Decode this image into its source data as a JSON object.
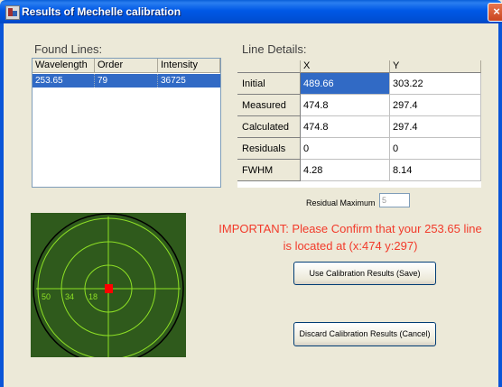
{
  "window": {
    "title": "Results of Mechelle calibration",
    "close_glyph": "×"
  },
  "found_lines": {
    "label": "Found Lines:",
    "columns": [
      "Wavelength",
      "Order",
      "Intensity"
    ],
    "rows": [
      {
        "wavelength": "253.65",
        "order": "79",
        "intensity": "36725"
      }
    ]
  },
  "line_details": {
    "label": "Line Details:",
    "columns": [
      "X",
      "Y"
    ],
    "rows": [
      {
        "name": "Initial",
        "x": "489.66",
        "y": "303.22"
      },
      {
        "name": "Measured",
        "x": "474.8",
        "y": "297.4"
      },
      {
        "name": "Calculated",
        "x": "474.8",
        "y": "297.4"
      },
      {
        "name": "Residuals",
        "x": "0",
        "y": "0"
      },
      {
        "name": "FWHM",
        "x": "4.28",
        "y": "8.14"
      }
    ]
  },
  "residual_maximum": {
    "label": "Residual Maximum",
    "value": "5"
  },
  "important_message": {
    "line1": "IMPORTANT: Please Confirm that your 253.65 line",
    "line2": "is located at (x:474 y:297)"
  },
  "buttons": {
    "save": "Use Calibration Results (Save)",
    "cancel": "Discard Calibration Results (Cancel)"
  },
  "target_display": {
    "ring_labels": [
      "50",
      "34",
      "18"
    ]
  },
  "colors": {
    "title_bar": "#0058e6",
    "selection": "#316ac5",
    "important_text": "#f23a2a",
    "target_background": "#2f5a1c",
    "target_lines": "#8ee025",
    "target_marker": "#ff0000"
  }
}
